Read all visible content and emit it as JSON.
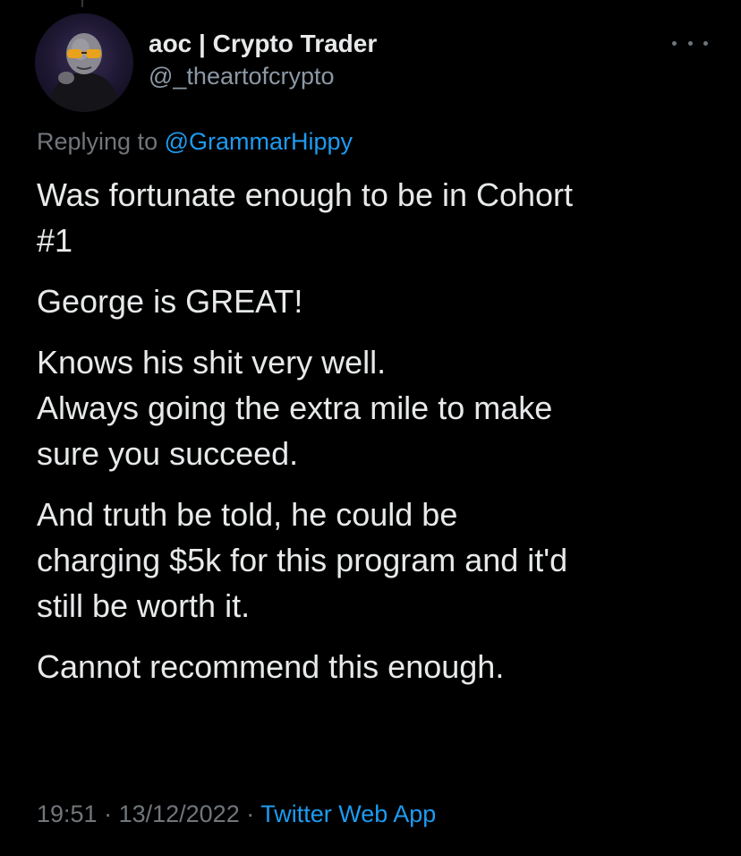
{
  "author": {
    "display_name": "aoc | Crypto Trader",
    "handle": "@_theartofcrypto",
    "avatar_icon": "profile-avatar"
  },
  "more_icon": "more-options-icon",
  "reply": {
    "prefix": "Replying to",
    "mention": "@GrammarHippy"
  },
  "tweet": {
    "paragraphs": [
      "Was fortunate enough to be in Cohort\n#1",
      "George is GREAT!",
      "Knows his shit very well.\nAlways going the extra mile to make\nsure you succeed.",
      "And truth be told, he could be\ncharging $5k for this program and it'd\nstill be worth it.",
      "Cannot recommend this enough."
    ]
  },
  "meta": {
    "time": "19:51",
    "separator": " · ",
    "date": "13/12/2022",
    "source": "Twitter Web App"
  },
  "colors": {
    "background": "#000000",
    "text": "#e7e9ea",
    "muted": "#71767b",
    "link": "#1d9bf0"
  }
}
